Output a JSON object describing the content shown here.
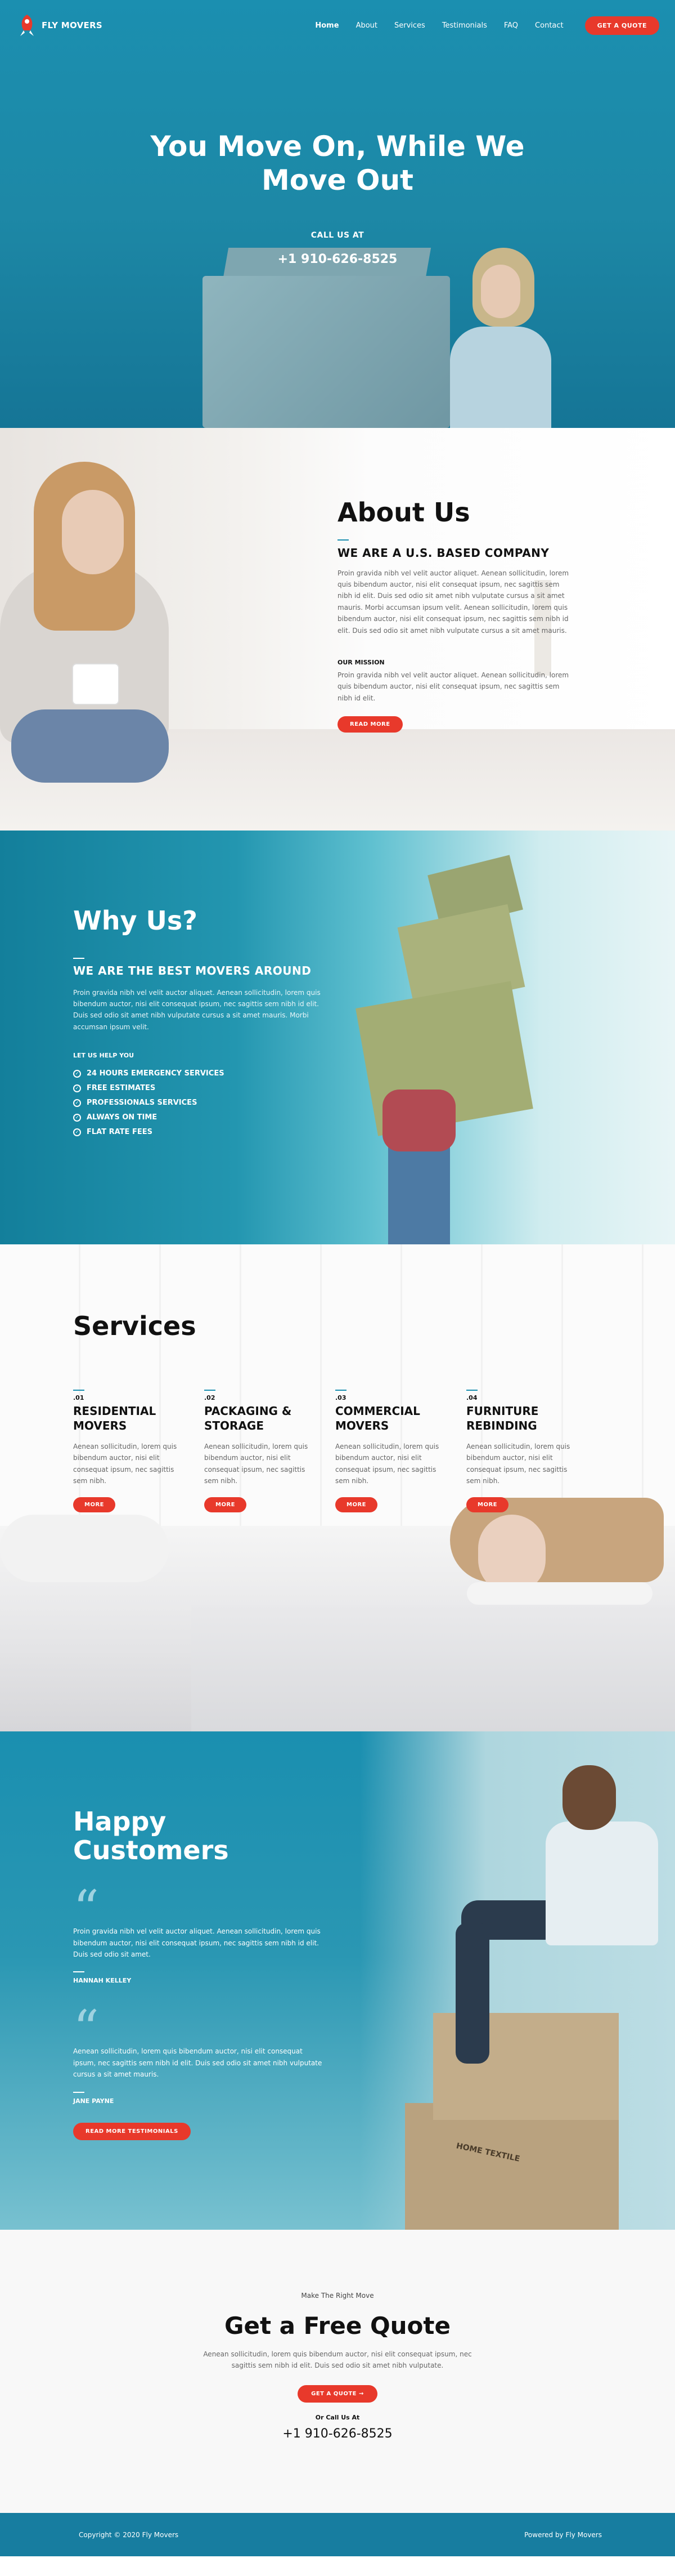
{
  "colors": {
    "brand_blue": "#1b8fb0",
    "accent_red": "#e8392b",
    "footer_blue": "#177da0"
  },
  "header": {
    "logo_text": "FLY MOVERS",
    "menu": [
      "Home",
      "About",
      "Services",
      "Testimonials",
      "FAQ",
      "Contact"
    ],
    "cta": "GET A QUOTE"
  },
  "hero": {
    "title": "You Move On, While We Move Out",
    "call_label": "CALL US AT",
    "phone": "+1 910-626-8525"
  },
  "about": {
    "title": "About Us",
    "subtitle": "WE ARE A U.S. BASED COMPANY",
    "body": "Proin gravida nibh vel velit auctor aliquet. Aenean sollicitudin, lorem quis bibendum auctor, nisi elit consequat ipsum, nec sagittis sem nibh id elit. Duis sed odio sit amet nibh vulputate cursus a sit amet mauris. Morbi accumsan ipsum velit. Aenean sollicitudin, lorem quis bibendum auctor, nisi elit consequat ipsum, nec sagittis sem nibh id elit. Duis sed odio sit amet nibh vulputate cursus a sit amet mauris.",
    "mission_label": "OUR MISSION",
    "mission_body": "Proin gravida nibh vel velit auctor aliquet. Aenean sollicitudin, lorem quis bibendum auctor, nisi elit consequat ipsum, nec sagittis sem nibh id elit.",
    "button": "READ MORE"
  },
  "why": {
    "title": "Why Us?",
    "subtitle": "WE ARE THE BEST MOVERS AROUND",
    "body": "Proin gravida nibh vel velit auctor aliquet. Aenean sollicitudin, lorem quis bibendum auctor, nisi elit consequat ipsum, nec sagittis sem nibh id elit. Duis sed odio sit amet nibh vulputate cursus a sit amet mauris. Morbi accumsan ipsum velit.",
    "help_label": "LET US HELP YOU",
    "features": [
      "24 HOURS EMERGENCY SERVICES",
      "FREE ESTIMATES",
      "PROFESSIONALS SERVICES",
      "ALWAYS ON TIME",
      "FLAT RATE FEES"
    ]
  },
  "services": {
    "title": "Services",
    "items": [
      {
        "num": ".01",
        "title": "RESIDENTIAL MOVERS",
        "body": "Aenean sollicitudin, lorem quis bibendum auctor, nisi elit consequat ipsum, nec sagittis sem nibh.",
        "button": "MORE"
      },
      {
        "num": ".02",
        "title": "PACKAGING & STORAGE",
        "body": "Aenean sollicitudin, lorem quis bibendum auctor, nisi elit consequat ipsum, nec sagittis sem nibh.",
        "button": "MORE"
      },
      {
        "num": ".03",
        "title": "COMMERCIAL MOVERS",
        "body": "Aenean sollicitudin, lorem quis bibendum auctor, nisi elit consequat ipsum, nec sagittis sem nibh.",
        "button": "MORE"
      },
      {
        "num": ".04",
        "title": "FURNITURE REBINDING",
        "body": "Aenean sollicitudin, lorem quis bibendum auctor, nisi elit consequat ipsum, nec sagittis sem nibh.",
        "button": "MORE"
      }
    ]
  },
  "testimonials": {
    "title": "Happy Customers",
    "items": [
      {
        "quote": "Proin gravida nibh vel velit auctor aliquet. Aenean sollicitudin, lorem quis bibendum auctor, nisi elit consequat ipsum, nec sagittis sem nibh id elit. Duis sed odio sit amet.",
        "name": "HANNAH KELLEY"
      },
      {
        "quote": "Aenean sollicitudin, lorem quis bibendum auctor, nisi elit consequat ipsum, nec sagittis sem nibh id elit. Duis sed odio sit amet nibh vulputate cursus a sit amet mauris.",
        "name": "JANE PAYNE"
      }
    ],
    "button": "READ MORE TESTIMONIALS",
    "box_print": "HOME TEXTILE"
  },
  "quote": {
    "kicker": "Make The Right Move",
    "title": "Get a Free Quote",
    "body": "Aenean sollicitudin, lorem quis bibendum auctor, nisi elit consequat ipsum, nec sagittis sem nibh id elit. Duis sed odio sit amet nibh vulputate.",
    "button": "GET A QUOTE →",
    "or_label": "Or Call Us At",
    "phone": "+1 910-626-8525"
  },
  "footer": {
    "copyright": "Copyright © 2020 Fly Movers",
    "powered": "Powered by Fly Movers"
  }
}
